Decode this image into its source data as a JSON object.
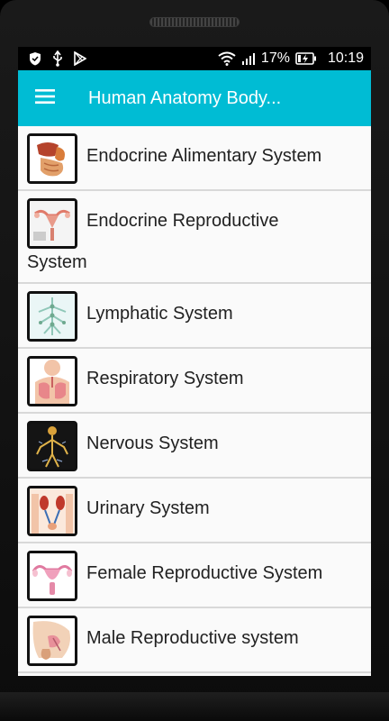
{
  "status_bar": {
    "battery": "17%",
    "time": "10:19",
    "icons": [
      "shield-icon",
      "usb-icon",
      "play-store-icon",
      "wifi-icon",
      "signal-icon",
      "battery-charging-icon"
    ]
  },
  "app_bar": {
    "title": "Human Anatomy Body..."
  },
  "items": [
    {
      "label": "Endocrine Alimentary System",
      "icon": "digestive-system-icon"
    },
    {
      "label_line1": "Endocrine Reproductive",
      "label_line2": "System",
      "icon": "reproductive-system-icon"
    },
    {
      "label": "Lymphatic System",
      "icon": "lymphatic-system-icon"
    },
    {
      "label": "Respiratory System",
      "icon": "lungs-icon"
    },
    {
      "label": "Nervous System",
      "icon": "nervous-system-icon"
    },
    {
      "label": "Urinary System",
      "icon": "kidneys-icon"
    },
    {
      "label": "Female Reproductive System",
      "icon": "uterus-icon"
    },
    {
      "label": "Male Reproductive system",
      "icon": "male-pelvis-icon"
    }
  ],
  "colors": {
    "app_bar": "#00bcd4",
    "list_background": "#fafafa",
    "divider": "#d8d8d8"
  }
}
